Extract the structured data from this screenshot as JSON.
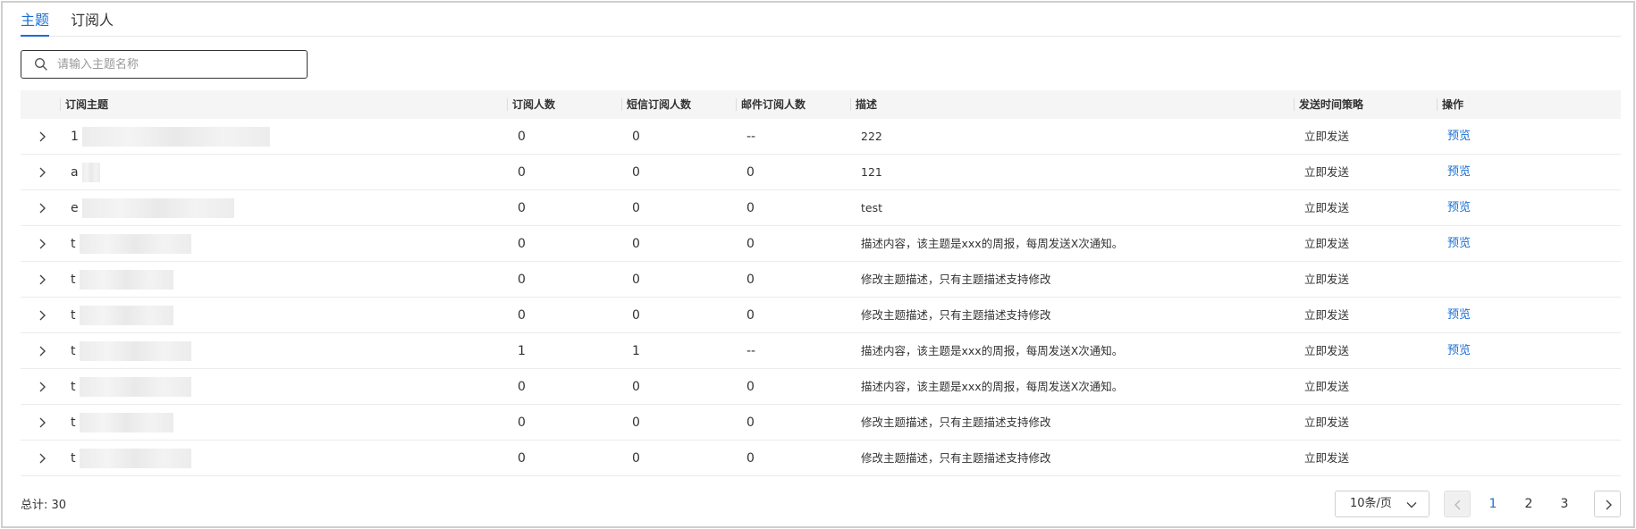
{
  "tabs": [
    {
      "label": "主题",
      "active": true
    },
    {
      "label": "订阅人",
      "active": false
    }
  ],
  "search": {
    "placeholder": "请输入主题名称",
    "value": ""
  },
  "table": {
    "columns": [
      "订阅主题",
      "订阅人数",
      "短信订阅人数",
      "邮件订阅人数",
      "描述",
      "发送时间策略",
      "操作"
    ],
    "rows": [
      {
        "topic_prefix": "1",
        "subscribers": "0",
        "sms": "0",
        "email": "--",
        "desc": "222",
        "strategy": "立即发送",
        "action": "预览"
      },
      {
        "topic_prefix": "a",
        "subscribers": "0",
        "sms": "0",
        "email": "0",
        "desc": "121",
        "strategy": "立即发送",
        "action": "预览"
      },
      {
        "topic_prefix": "e",
        "subscribers": "0",
        "sms": "0",
        "email": "0",
        "desc": "test",
        "strategy": "立即发送",
        "action": "预览"
      },
      {
        "topic_prefix": "t",
        "subscribers": "0",
        "sms": "0",
        "email": "0",
        "desc": "描述内容，该主题是xxx的周报，每周发送X次通知。",
        "strategy": "立即发送",
        "action": "预览"
      },
      {
        "topic_prefix": "t",
        "subscribers": "0",
        "sms": "0",
        "email": "0",
        "desc": "修改主题描述，只有主题描述支持修改",
        "strategy": "立即发送",
        "action": ""
      },
      {
        "topic_prefix": "t",
        "subscribers": "0",
        "sms": "0",
        "email": "0",
        "desc": "修改主题描述，只有主题描述支持修改",
        "strategy": "立即发送",
        "action": "预览"
      },
      {
        "topic_prefix": "t",
        "subscribers": "1",
        "sms": "1",
        "email": "--",
        "desc": "描述内容，该主题是xxx的周报，每周发送X次通知。",
        "strategy": "立即发送",
        "action": "预览"
      },
      {
        "topic_prefix": "t",
        "subscribers": "0",
        "sms": "0",
        "email": "0",
        "desc": "描述内容，该主题是xxx的周报，每周发送X次通知。",
        "strategy": "立即发送",
        "action": ""
      },
      {
        "topic_prefix": "t",
        "subscribers": "0",
        "sms": "0",
        "email": "0",
        "desc": "修改主题描述，只有主题描述支持修改",
        "strategy": "立即发送",
        "action": ""
      },
      {
        "topic_prefix": "t",
        "subscribers": "0",
        "sms": "0",
        "email": "0",
        "desc": "修改主题描述，只有主题描述支持修改",
        "strategy": "立即发送",
        "action": ""
      }
    ]
  },
  "footer": {
    "total": "总计: 30",
    "page_size": "10条/页",
    "pages": [
      "1",
      "2",
      "3"
    ],
    "current_page": "1"
  },
  "colors": {
    "accent": "#1a6fd4",
    "header_bg": "#f5f5f5",
    "border": "#ebebeb"
  }
}
